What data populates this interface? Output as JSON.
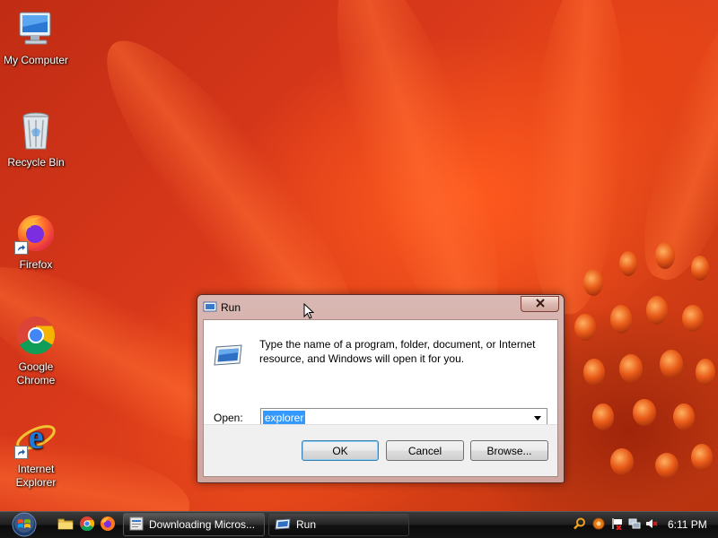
{
  "desktop": {
    "icons": [
      {
        "label": "My Computer",
        "icon": "my-computer-icon"
      },
      {
        "label": "Recycle Bin",
        "icon": "recycle-bin-icon"
      },
      {
        "label": "Firefox",
        "icon": "firefox-icon"
      },
      {
        "label": "Google\nChrome",
        "icon": "chrome-icon"
      },
      {
        "label": "Internet\nExplorer",
        "icon": "internet-explorer-icon"
      }
    ]
  },
  "run_dialog": {
    "title": "Run",
    "description": "Type the name of a program, folder, document, or Internet resource, and Windows will open it for you.",
    "open_label": "Open:",
    "open_value": "explorer",
    "ok_label": "OK",
    "cancel_label": "Cancel",
    "browse_label": "Browse..."
  },
  "taskbar": {
    "quick_launch": [
      "explorer-folder-icon",
      "chrome-icon",
      "firefox-icon"
    ],
    "tasks": [
      {
        "label": "Downloading Micros...",
        "icon": "download-page-icon",
        "active": false
      },
      {
        "label": "Run",
        "icon": "run-icon",
        "active": true
      }
    ],
    "tray_icons": [
      "search-icon",
      "update-icon",
      "flag-icon",
      "network-icon",
      "volume-muted-icon"
    ],
    "clock": "6:11 PM"
  },
  "colors": {
    "wallpaper_base": "#d8381a",
    "selection": "#3399ff",
    "dialog_frame": "#cfa69f",
    "taskbar": "#141414"
  }
}
